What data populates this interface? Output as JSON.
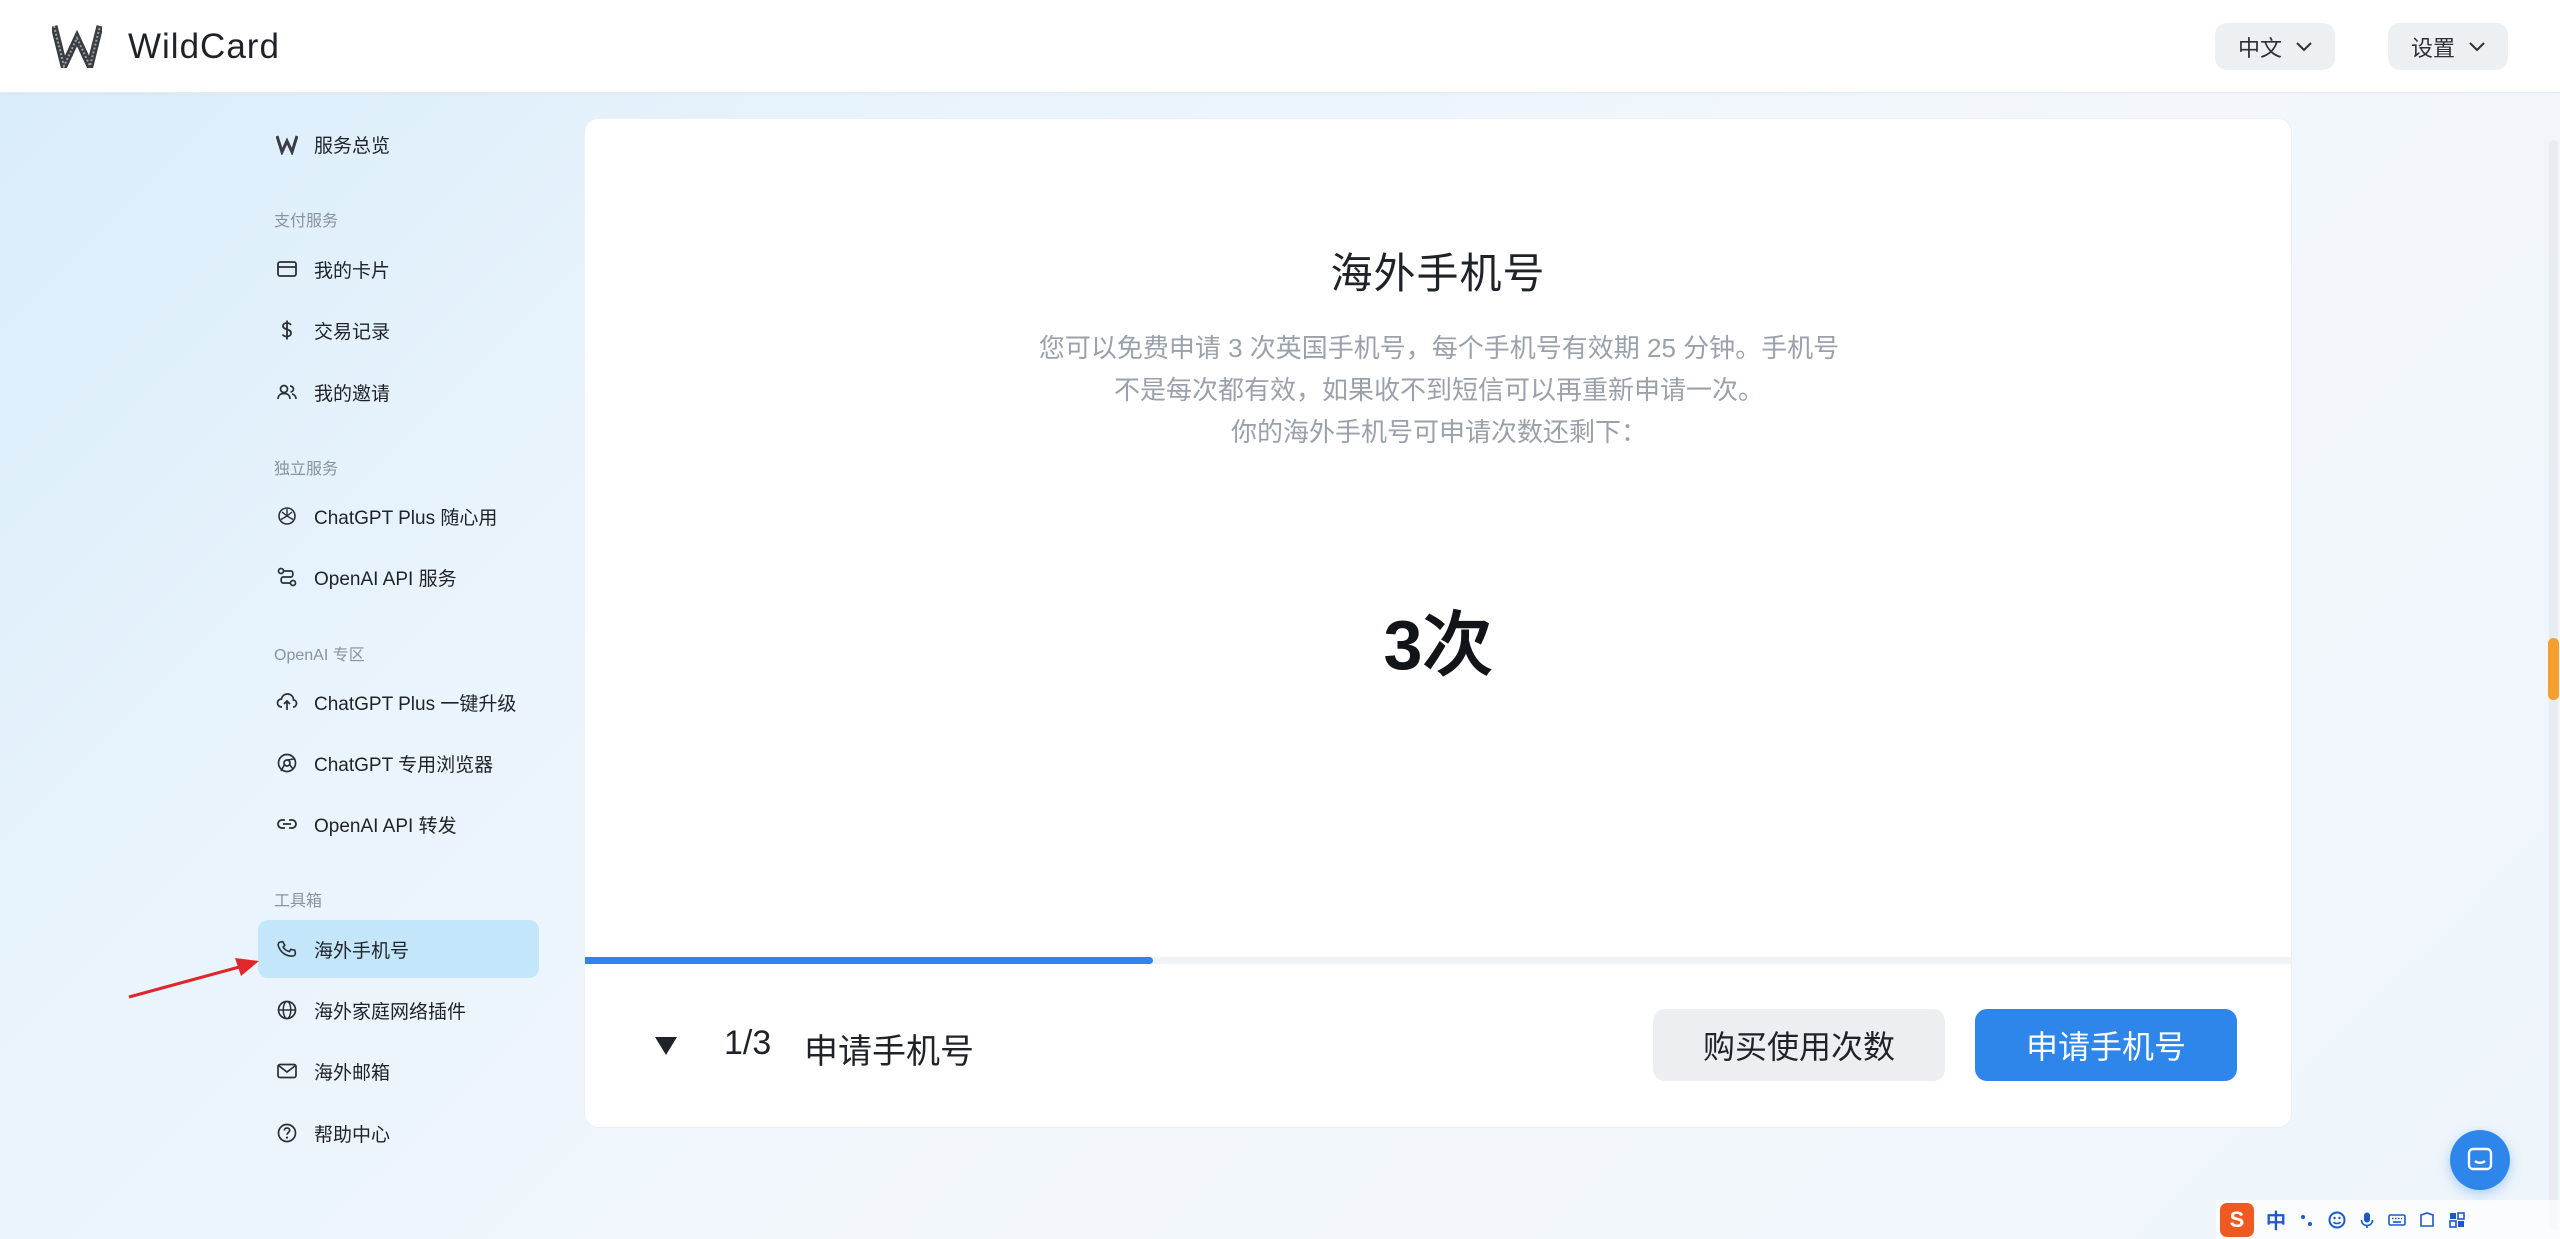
{
  "header": {
    "logo_text": "WildCard",
    "language_label": "中文",
    "settings_label": "设置"
  },
  "sidebar": {
    "overview": "服务总览",
    "sections": {
      "payment": "支付服务",
      "standalone": "独立服务",
      "openai": "OpenAI 专区",
      "toolbox": "工具箱"
    },
    "items": {
      "my_cards": "我的卡片",
      "transactions": "交易记录",
      "invites": "我的邀请",
      "chatgpt_plus_anytime": "ChatGPT Plus 随心用",
      "openai_api_service": "OpenAI API 服务",
      "chatgpt_upgrade": "ChatGPT Plus 一键升级",
      "chatgpt_browser": "ChatGPT 专用浏览器",
      "openai_api_forward": "OpenAI API 转发",
      "overseas_phone": "海外手机号",
      "home_network_plugin": "海外家庭网络插件",
      "overseas_email": "海外邮箱",
      "help_center": "帮助中心"
    }
  },
  "main": {
    "title": "海外手机号",
    "description_line1": "您可以免费申请 3 次英国手机号，每个手机号有效期 25 分钟。手机号",
    "description_line2": "不是每次都有效，如果收不到短信可以再重新申请一次。",
    "description_line3": "你的海外手机号可申请次数还剩下：",
    "remaining_count": "3次",
    "step_number": "1/3",
    "step_label": "申请手机号",
    "progress": 0.333,
    "buy_button": "购买使用次数",
    "apply_button": "申请手机号"
  },
  "ime": {
    "logo": "S",
    "mode": "中"
  },
  "colors": {
    "accent": "#2f86ea",
    "active_bg": "#c4e6fb",
    "annotation_arrow": "#e0272b"
  }
}
